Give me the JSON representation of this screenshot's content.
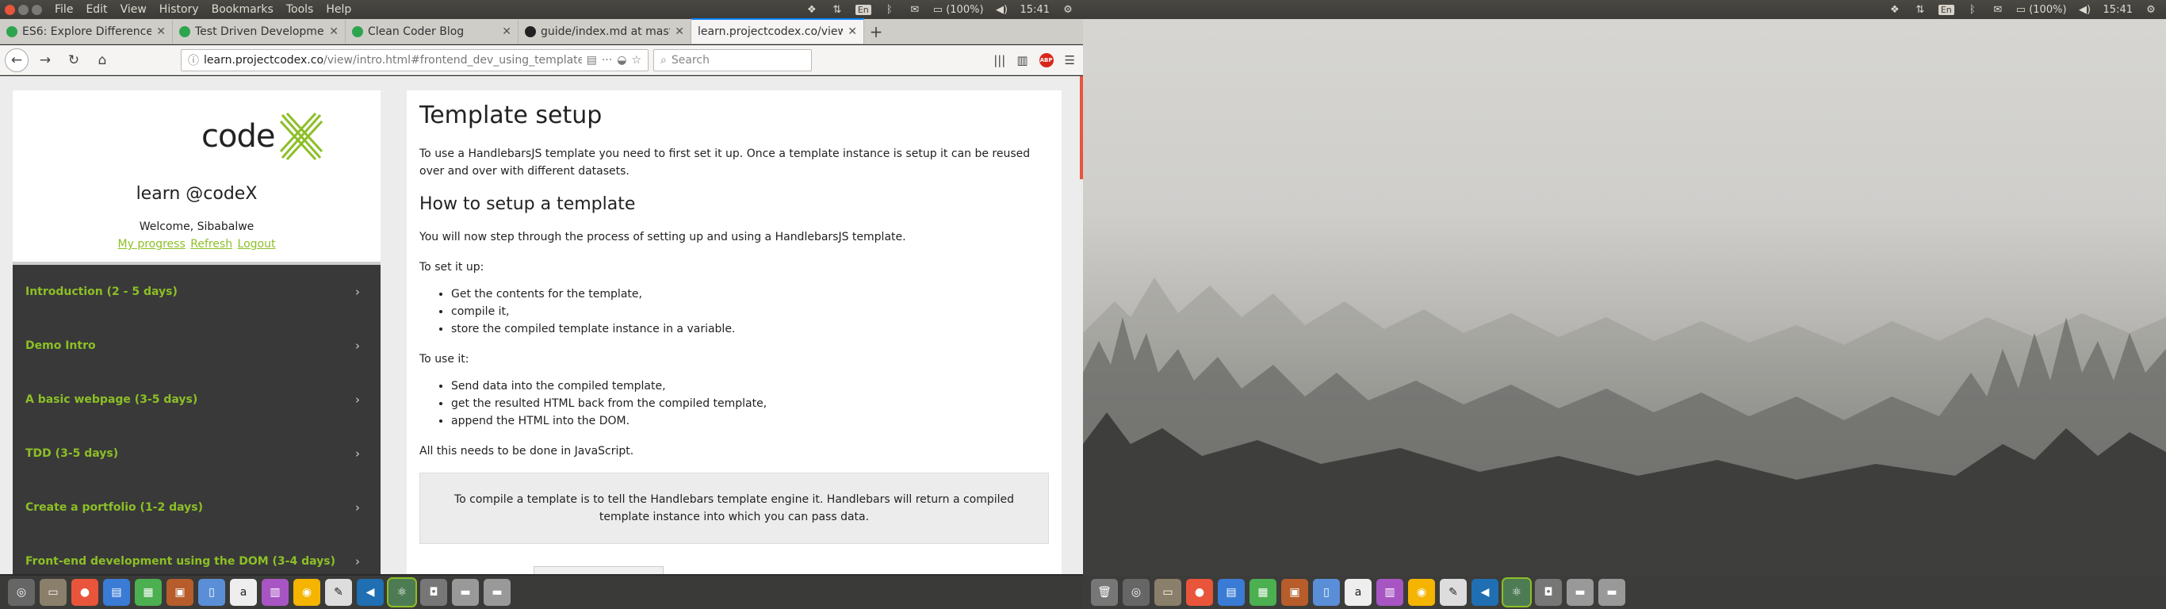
{
  "menubar": {
    "items": [
      "File",
      "Edit",
      "View",
      "History",
      "Bookmarks",
      "Tools",
      "Help"
    ],
    "battery": "(100%)",
    "time": "15:41",
    "lang": "En"
  },
  "tabs": [
    {
      "title": "ES6: Explore Difference",
      "favicon_color": "#2ea44f"
    },
    {
      "title": "Test Driven Developmen",
      "favicon_color": "#2ea44f"
    },
    {
      "title": "Clean Coder Blog",
      "favicon_color": "#2ea44f"
    },
    {
      "title": "guide/index.md at mast",
      "favicon_color": "#222222"
    },
    {
      "title": "learn.projectcodex.co/view",
      "favicon_color": "#2ea44f"
    }
  ],
  "navbar": {
    "url_host": "learn.projectcodex.co",
    "url_path": "/view/intro.html#frontend_dev_using_templates_se",
    "search_placeholder": "Search",
    "abp_label": "ABP"
  },
  "sidebar": {
    "logo_word": "code",
    "title": "learn @codeX",
    "welcome": "Welcome, Sibabalwe",
    "links": [
      "My progress",
      "Refresh",
      "Logout"
    ],
    "items": [
      "Introduction (2 - 5 days)",
      "Demo Intro",
      "A basic webpage (3-5 days)",
      "TDD (3-5 days)",
      "Create a portfolio (1-2 days)",
      "Front-end development using the DOM (3-4 days)"
    ],
    "accent_color": "#8cbf26"
  },
  "content": {
    "h1": "Template setup",
    "p1": "To use a HandlebarsJS template you need to first set it up. Once a template instance is setup it can be reused over and over with different datasets.",
    "h2": "How to setup a template",
    "p2": "You will now step through the process of setting up and using a HandlebarsJS template.",
    "p3": "To set it up:",
    "list1": [
      "Get the contents for the template,",
      "compile it,",
      "store the compiled template instance in a variable."
    ],
    "p4": "To use it:",
    "list2": [
      "Send data into the compiled template,",
      "get the resulted HTML back from the compiled template,",
      "append the HTML into the DOM."
    ],
    "p5": "All this needs to be done in JavaScript.",
    "callout": "To compile a template is to tell the Handlebars template engine it. Handlebars will return a compiled template instance into which you can pass data."
  },
  "right_screen": {
    "battery": "(100%)",
    "time": "15:41",
    "lang": "En"
  }
}
